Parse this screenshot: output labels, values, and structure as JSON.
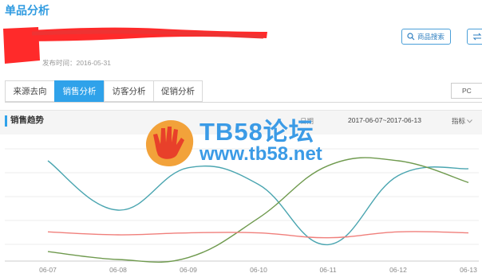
{
  "page_title": "单品分析",
  "publish_date": "发布时间：2016-05-31",
  "buttons": {
    "search_label": "商品搜索"
  },
  "tabs": [
    {
      "label": "来源去向",
      "active": false
    },
    {
      "label": "销售分析",
      "active": true
    },
    {
      "label": "访客分析",
      "active": false
    },
    {
      "label": "促销分析",
      "active": false
    }
  ],
  "terminal_select": "PC",
  "trend": {
    "title": "销售趋势",
    "range_prefix": "日期",
    "date_range": "2017-06-07~2017-06-13",
    "metric_label": "指标"
  },
  "watermark": {
    "line1": "TB58论坛",
    "line2": "www.tb58.net"
  },
  "colors": {
    "accent": "#2fa2ea",
    "series_teal": "#4aa5b0",
    "series_green": "#6f9a4e",
    "series_red": "#f07f7b"
  },
  "chart_data": {
    "type": "line",
    "x": [
      "06-07",
      "06-08",
      "06-09",
      "06-10",
      "06-11",
      "06-12",
      "06-13"
    ],
    "ylim": [
      0,
      100
    ],
    "series": [
      {
        "values": [
          100,
          50,
          93,
          76,
          15,
          85,
          92
        ]
      },
      {
        "values": [
          8,
          0,
          2,
          42,
          95,
          100,
          78
        ]
      },
      {
        "values": [
          28,
          25,
          27,
          27,
          22,
          28,
          27
        ]
      }
    ]
  }
}
